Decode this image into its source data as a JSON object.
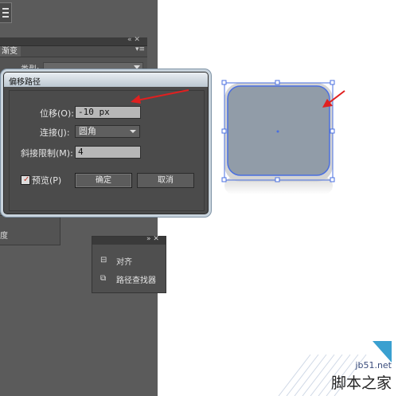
{
  "sidebar": {
    "menu_icon": "hamburger-icon",
    "panel_header_controls": "« ✕",
    "tab_label": "渐变",
    "tab_menu": "▾≡",
    "type_label": "类型:",
    "lower_label": "度"
  },
  "float_panel": {
    "controls": "» ✕",
    "items": [
      {
        "icon": "align-icon",
        "label": "对齐"
      },
      {
        "icon": "pathfinder-icon",
        "label": "路径查找器"
      }
    ]
  },
  "dialog": {
    "title": "偏移路径",
    "offset_label": "位移(O):",
    "offset_value": "-10 px",
    "join_label": "连接(J):",
    "join_value": "圆角",
    "miter_label": "斜接限制(M):",
    "miter_value": "4",
    "preview_label": "预览(P)",
    "preview_checked": true,
    "ok_label": "确定",
    "cancel_label": "取消"
  },
  "canvas": {
    "shape_fill": "#919ca8",
    "selection_color": "#4a6fe0",
    "arrow_color": "#e02020"
  },
  "watermark": {
    "site": "jb51.net",
    "name": "脚本之家"
  }
}
